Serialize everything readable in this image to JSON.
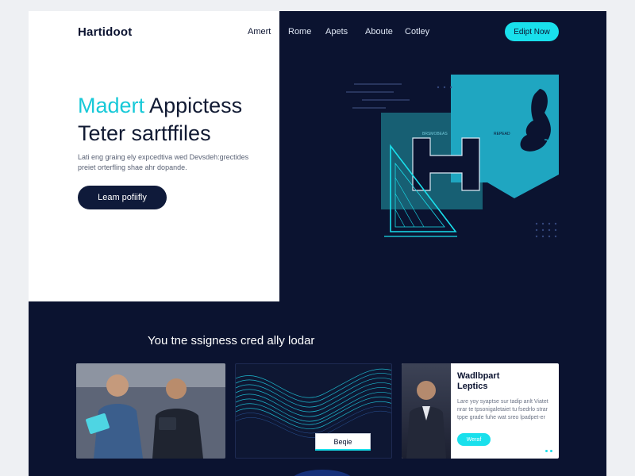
{
  "header": {
    "brand": "Hartidoot",
    "nav": [
      "Amert",
      "Rome",
      "Apets",
      "Aboute",
      "Cotley"
    ],
    "cta_label": "Edipt Now"
  },
  "hero": {
    "headline_accent": "Madert",
    "headline_rest": " Appictess",
    "headline_line2": "Teter sartffiles",
    "subtext_line1": "Lati eng graing ely expcedtiva wed Devsdeh:grectides",
    "subtext_line2": "preiet orterfling shae ahr dopande.",
    "button_label": "Leam pofiifly"
  },
  "illustration": {
    "label_left": "BRSMOBEAS",
    "label_right": "REPEAD"
  },
  "section": {
    "title": "You tne ssigness cred ally lodar"
  },
  "cards": {
    "wave_button": "Beqie",
    "profile_title": "Wadlbpart Leptics",
    "profile_text": "Lare yoy syaptse sur tadip anlt Viatet nrar te tpsonigaletaiet tu fsedrlo strar tppe grade fuhe wat sreo lpadpet-er",
    "profile_button": "Weraf"
  },
  "colors": {
    "accent": "#19e0ec",
    "navy": "#0b1330",
    "white": "#ffffff"
  }
}
